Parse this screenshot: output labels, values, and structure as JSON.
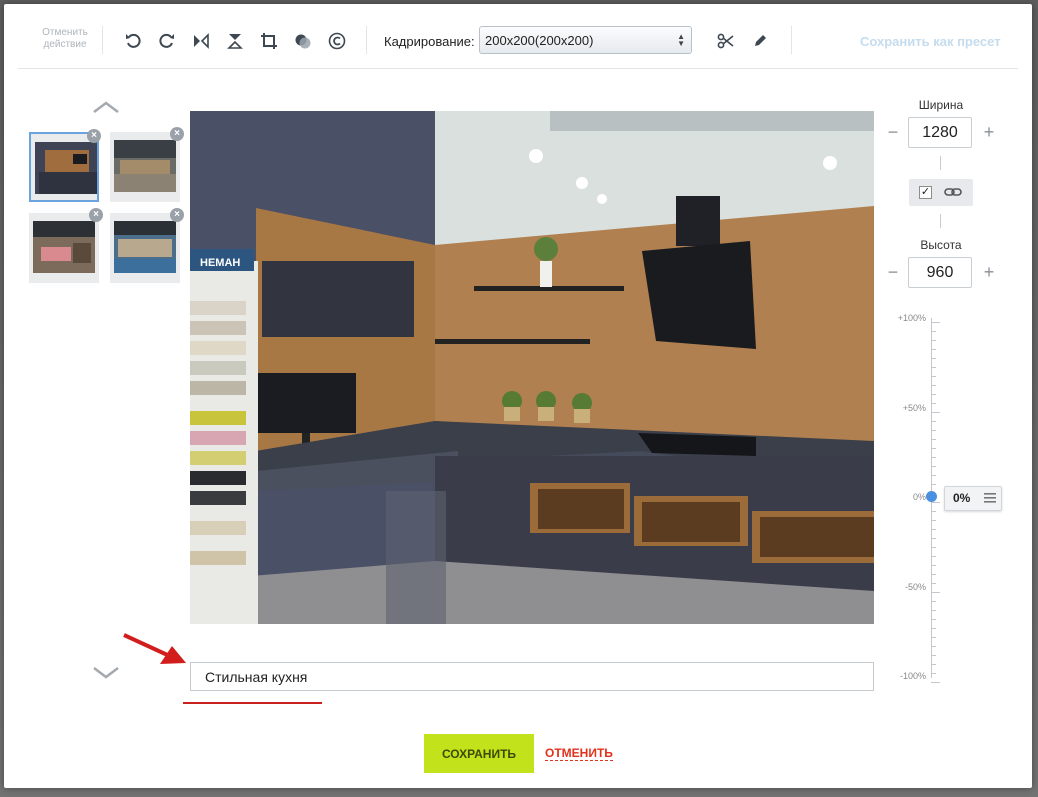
{
  "toolbar": {
    "undo_action": "Отменить действие",
    "crop_label": "Кадрирование:",
    "crop_value": "200x200(200x200)",
    "save_preset": "Сохранить как пресет"
  },
  "thumbnails": [
    {
      "name": "kitchen-dark",
      "active": true
    },
    {
      "name": "showroom-hall",
      "active": false
    },
    {
      "name": "lounge-pink",
      "active": false
    },
    {
      "name": "exhibition-stand",
      "active": false
    }
  ],
  "dimensions": {
    "width_label": "Ширина",
    "width_value": "1280",
    "height_label": "Высота",
    "height_value": "960"
  },
  "scale": {
    "labels": [
      "+100%",
      "+50%",
      "0%",
      "-50%",
      "-100%"
    ],
    "current": "0%"
  },
  "photo": {
    "brand_text": "НЕМАН"
  },
  "caption": {
    "value": "Стильная кухня"
  },
  "buttons": {
    "save": "СОХРАНИТЬ",
    "cancel": "ОТМЕНИТЬ"
  },
  "colors": {
    "save_bg": "#c2e21c",
    "cancel": "#e0321c",
    "active_thumb": "#6aa3de",
    "slider_knob": "#4a8fe0"
  },
  "icons": [
    "undo-icon",
    "redo-icon",
    "flip-horizontal-icon",
    "flip-vertical-icon",
    "crop-icon",
    "filter-icon",
    "copyright-icon",
    "scissors-icon",
    "pencil-icon"
  ]
}
